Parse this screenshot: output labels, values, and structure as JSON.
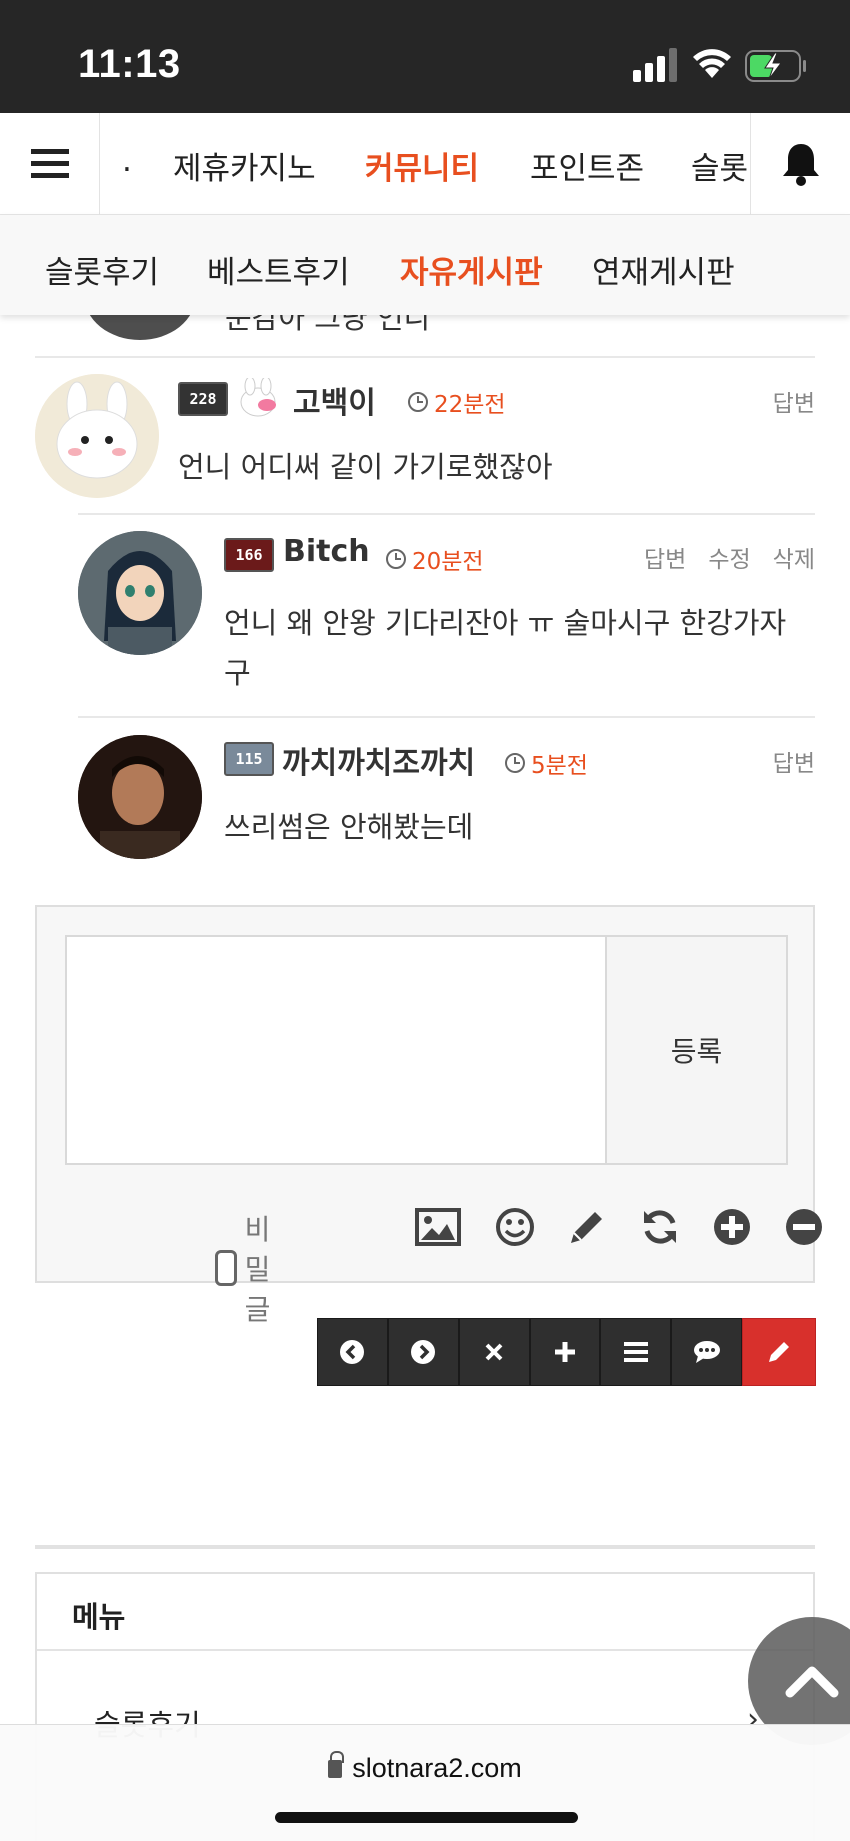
{
  "status_bar": {
    "time": "11:13"
  },
  "top_nav": {
    "items": [
      ".",
      "제휴카지노",
      "커뮤니티",
      "포인트존",
      "슬롯"
    ],
    "active_index": 2
  },
  "sub_nav": {
    "items": [
      "슬롯후기",
      "베스트후기",
      "자유게시판",
      "연재게시판"
    ],
    "active_index": 2
  },
  "partial_comment": {
    "text": "눈감아 그냥 언니"
  },
  "comments": [
    {
      "level": "228",
      "nickname": "고백이",
      "time": "22분전",
      "actions": [
        "답변"
      ],
      "body": "언니 어디써 같이 가기로했잖아"
    },
    {
      "level": "166",
      "nickname": "Bitch",
      "time": "20분전",
      "actions": [
        "답변",
        "수정",
        "삭제"
      ],
      "body_lines": [
        "언니 왜 안왕 기다리잔아 ㅠ 술마시구 한강가자",
        "구"
      ]
    },
    {
      "level": "115",
      "nickname": "까치까치조까치",
      "time": "5분전",
      "actions": [
        "답변"
      ],
      "body": "쓰리썸은 안해봤는데"
    }
  ],
  "comment_form": {
    "submit_label": "등록",
    "secret_label": "비밀글",
    "tool_icons": [
      "image-icon",
      "smile-icon",
      "pencil-icon",
      "refresh-icon",
      "plus-circle-icon",
      "minus-circle-icon"
    ]
  },
  "action_bar": {
    "buttons": [
      "prev-icon",
      "next-icon",
      "close-icon",
      "plus-icon",
      "list-icon",
      "comment-icon",
      "write-icon"
    ]
  },
  "menu_box": {
    "title": "메뉴",
    "first_item": "슬롯후기",
    "chevron": "›"
  },
  "browser": {
    "url": "slotnara2.com"
  },
  "colors": {
    "accent": "#e84f1f",
    "write_button": "#d8302c",
    "status_bar": "#262626"
  }
}
